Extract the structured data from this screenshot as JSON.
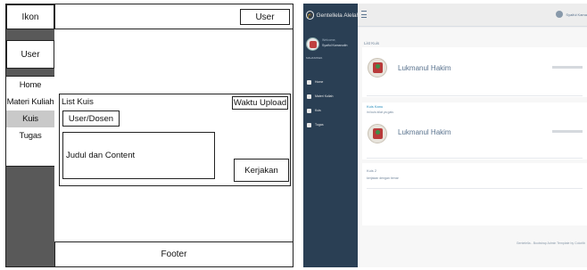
{
  "wireframe": {
    "logo_label": "Ikon",
    "top_user_label": "User",
    "side_user_label": "User",
    "menu": [
      {
        "label": "Home",
        "active": false
      },
      {
        "label": "Materi Kuliah",
        "active": false
      },
      {
        "label": "Kuis",
        "active": true
      },
      {
        "label": "Tugas",
        "active": false
      }
    ],
    "panel": {
      "title": "List Kuis",
      "upload_time_label": "Waktu Upload",
      "user_label": "User/Dosen",
      "content_label": "Judul dan Content",
      "action_label": "Kerjakan"
    },
    "footer_label": "Footer"
  },
  "app": {
    "brand": "Gentellela Alela!",
    "profile": {
      "welcome": "Welcome,",
      "name": "Syaiful Kamarudin",
      "role": "MAHASISWA"
    },
    "nav": [
      "Home",
      "Materi Kuliah",
      "Kuis",
      "Tugas"
    ],
    "top_user": "Syaiful Kama",
    "main_title": "List Kuis",
    "posts": [
      {
        "author": "Lukmanul Hakim",
        "title": "",
        "desc": ""
      },
      {
        "author": "Lukmanul Hakim",
        "title": "Kuis Kanu",
        "desc": "ini kuis kilat ya gais"
      },
      {
        "author": "",
        "title": "Kuis 2",
        "desc": "kerjakan dengan benar"
      }
    ],
    "footer": "Gentelella - Bootstrap Admin Template by Colorlib"
  },
  "colors": {
    "sidebar_dark": "#2a3f54",
    "wireframe_side": "#595959",
    "menu_active": "#c9c9c9",
    "text_blue": "#5a738e"
  }
}
